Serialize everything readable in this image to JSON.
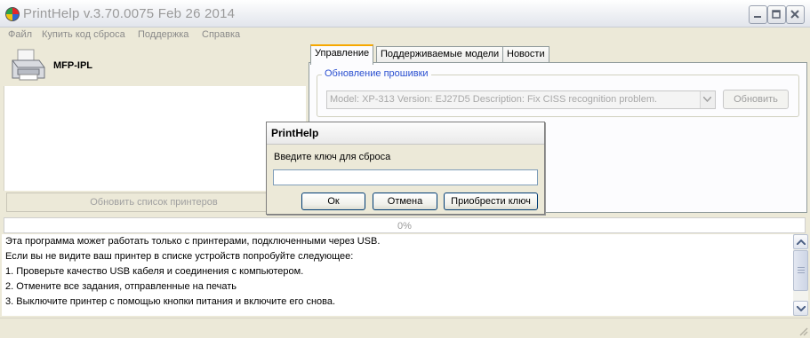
{
  "window": {
    "title": "PrintHelp v.3.70.0075 Feb 26 2014"
  },
  "menu": [
    "Файл",
    "Купить код сброса",
    "Поддержка",
    "Справка"
  ],
  "printer": {
    "name": "MFP-IPL",
    "refresh_label": "Обновить список принтеров"
  },
  "tabs": [
    "Управление",
    "Поддерживаемые модели",
    "Новости"
  ],
  "firmware": {
    "group_title": "Обновление прошивки",
    "select_value": "Model: XP-313 Version: EJ27D5 Description: Fix CISS recognition problem.",
    "update_label": "Обновить"
  },
  "progress": {
    "text": "0%",
    "value": 0
  },
  "log": [
    "Эта программа может работать только с принтерами, подключенными через USB.",
    "Если вы не видите ваш принтер в списке устройств попробуйте следующее:",
    "1. Проверьте качество USB кабеля и соединения с компьютером.",
    "2. Отмените все задания, отправленные на печать",
    "3. Выключите принтер с помощью кнопки питания и включите его снова."
  ],
  "dialog": {
    "title": "PrintHelp",
    "prompt": "Введите ключ для сброса",
    "input_value": "",
    "ok_label": "Ок",
    "cancel_label": "Отмена",
    "buy_label": "Приобрести ключ"
  }
}
